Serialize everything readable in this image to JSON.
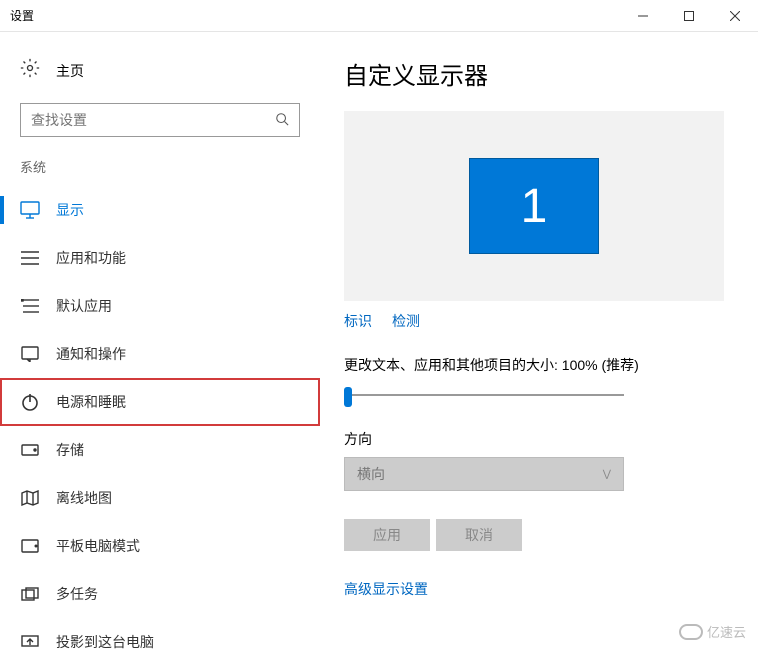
{
  "window": {
    "title": "设置"
  },
  "sidebar": {
    "home_label": "主页",
    "search_placeholder": "查找设置",
    "category_label": "系统",
    "items": [
      {
        "label": "显示",
        "icon": "monitor-icon",
        "selected": true
      },
      {
        "label": "应用和功能",
        "icon": "list-icon"
      },
      {
        "label": "默认应用",
        "icon": "default-app-icon"
      },
      {
        "label": "通知和操作",
        "icon": "notification-icon"
      },
      {
        "label": "电源和睡眠",
        "icon": "power-icon",
        "highlighted": true
      },
      {
        "label": "存储",
        "icon": "storage-icon"
      },
      {
        "label": "离线地图",
        "icon": "map-icon"
      },
      {
        "label": "平板电脑模式",
        "icon": "tablet-icon"
      },
      {
        "label": "多任务",
        "icon": "multitask-icon"
      },
      {
        "label": "投影到这台电脑",
        "icon": "project-icon"
      }
    ]
  },
  "main": {
    "heading": "自定义显示器",
    "monitor_number": "1",
    "identify_link": "标识",
    "detect_link": "检测",
    "scale_label": "更改文本、应用和其他项目的大小: 100% (推荐)",
    "orientation_label": "方向",
    "orientation_value": "横向",
    "apply_button": "应用",
    "cancel_button": "取消",
    "advanced_link": "高级显示设置"
  },
  "watermark": "亿速云"
}
